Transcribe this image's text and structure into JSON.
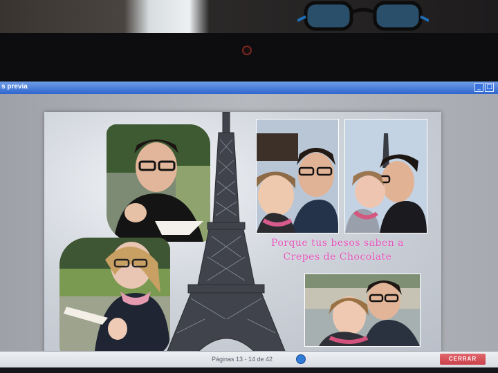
{
  "window": {
    "title": "s previa"
  },
  "collage": {
    "caption_line1": "Porque tus besos saben a",
    "caption_line2": "Crepes de Chocolate"
  },
  "footer": {
    "prev_label": "",
    "page_info": "Páginas 13 - 14 de 42",
    "next_label": "",
    "close_label": "CERRAR"
  },
  "colors": {
    "caption": "#e04fb8",
    "close_button": "#c9404a",
    "titlebar": "#2f66cf"
  }
}
